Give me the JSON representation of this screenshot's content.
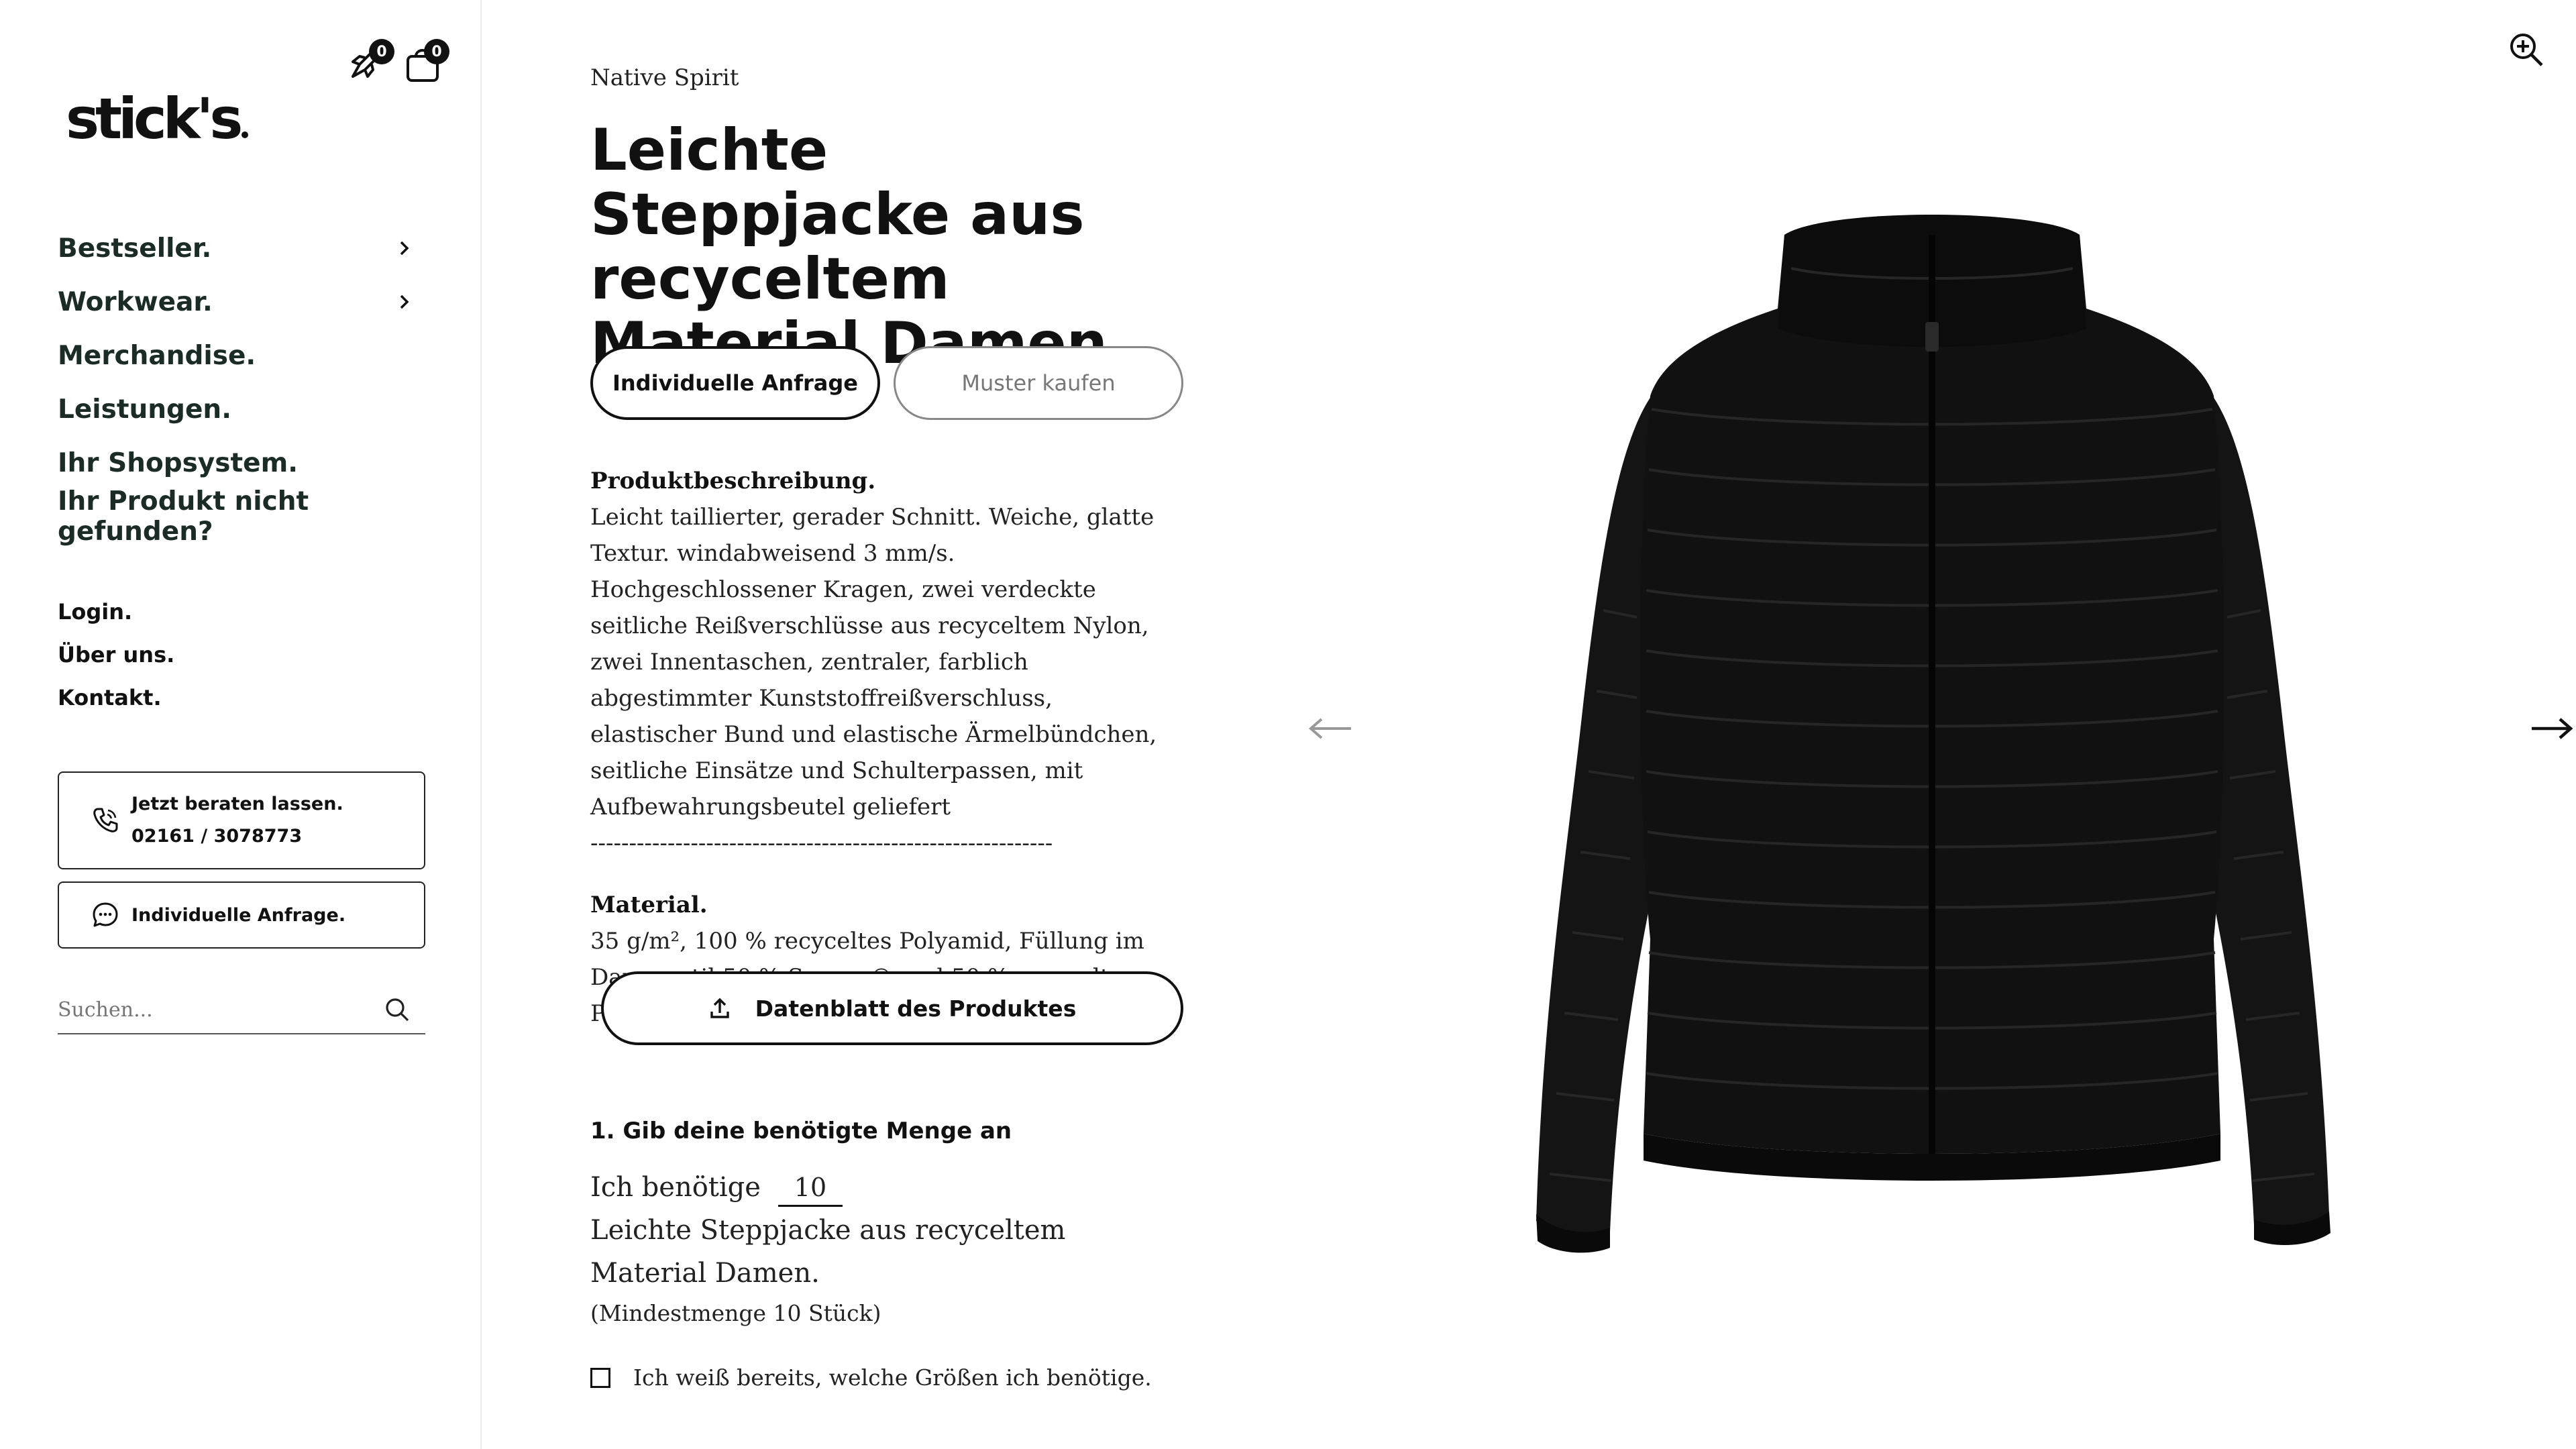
{
  "header": {
    "logo": "stick's",
    "wishlist_count": "0",
    "cart_count": "0"
  },
  "sidebar": {
    "nav": [
      {
        "label": "Bestseller.",
        "has_children": true
      },
      {
        "label": "Workwear.",
        "has_children": true
      },
      {
        "label": "Merchandise.",
        "has_children": false
      },
      {
        "label": "Leistungen.",
        "has_children": false
      },
      {
        "label": "Ihr Shopsystem.",
        "has_children": false
      },
      {
        "label": "Ihr Produkt nicht gefunden?",
        "has_children": false
      }
    ],
    "links": [
      "Login.",
      "Über uns.",
      "Kontakt."
    ],
    "consult": {
      "title": "Jetzt beraten lassen.",
      "phone": "02161 / 3078773"
    },
    "request_label": "Individuelle Anfrage.",
    "search_placeholder": "Suchen..."
  },
  "product": {
    "brand": "Native Spirit",
    "title": "Leichte Steppjacke aus recyceltem Material Damen",
    "btn_request": "Individuelle Anfrage",
    "btn_sample": "Muster kaufen",
    "desc_heading": "Produktbeschreibung.",
    "desc_text": "Leicht taillierter, gerader Schnitt. Weiche, glatte Textur. windabweisend 3 mm/s. Hochgeschlossener Kragen, zwei verdeckte seitliche Reißverschlüsse aus recyceltem Nylon, zwei Innentaschen, zentraler, farblich abgestimmter Kunststoffreißverschluss, elastischer Bund und elastische Ärmelbündchen, seitliche Einsätze und Schulterpassen, mit Aufbewahrungsbeutel geliefert",
    "divider": "------------------------------------------------------------",
    "material_heading": "Material.",
    "material_text": "35 g/m², 100 % recyceltes Polyamid, Füllung im Daunenstil 50 % Sorona® und 50 % recycelter Polyester",
    "datasheet_label": "Datenblatt des Produktes",
    "step1": "1. Gib deine benötigte Menge an",
    "qty_prefix": "Ich benötige",
    "qty_value": "10",
    "qty_suffix": "Leichte Steppjacke aus recyceltem Material Damen.",
    "min_qty": "(Mindestmenge 10 Stück)",
    "sizes_checkbox": "Ich weiß bereits, welche Größen ich benötige.",
    "sizes_checked": false
  },
  "gallery": {
    "image": "black quilted puffer jacket",
    "zoom_icon": "zoom-in-icon",
    "prev_icon": "arrow-left-icon",
    "next_icon": "arrow-right-icon"
  }
}
